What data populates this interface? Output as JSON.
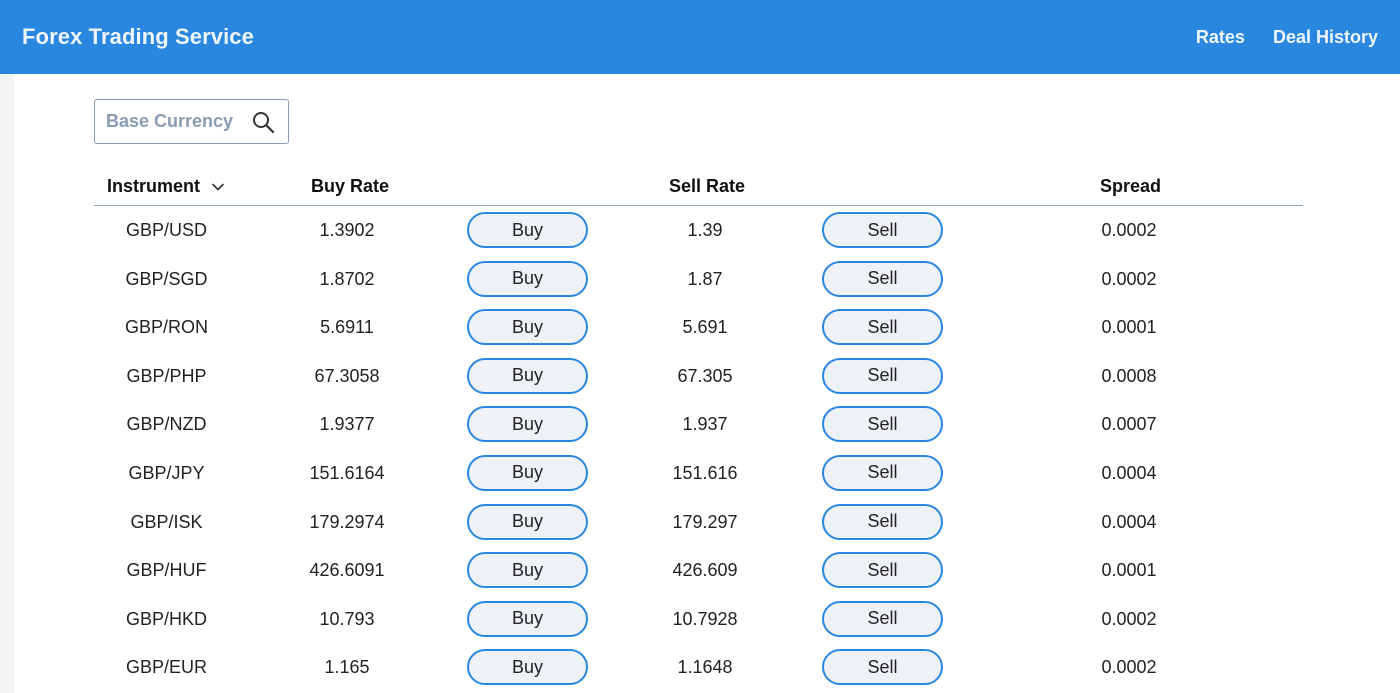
{
  "header": {
    "title": "Forex Trading Service",
    "nav": [
      {
        "label": "Rates"
      },
      {
        "label": "Deal History"
      }
    ],
    "bar_color": "#2a87e0"
  },
  "search": {
    "placeholder": "Base Currency",
    "value": "",
    "icon": "search-icon"
  },
  "table": {
    "headers": {
      "instrument": "Instrument",
      "buy_rate": "Buy Rate",
      "sell_rate": "Sell Rate",
      "spread": "Spread"
    },
    "sort_icon": "chevron-down-icon",
    "buy_label": "Buy",
    "sell_label": "Sell",
    "rows": [
      {
        "instrument": "GBP/USD",
        "buy_rate": "1.3902",
        "sell_rate": "1.39",
        "spread": "0.0002"
      },
      {
        "instrument": "GBP/SGD",
        "buy_rate": "1.8702",
        "sell_rate": "1.87",
        "spread": "0.0002"
      },
      {
        "instrument": "GBP/RON",
        "buy_rate": "5.6911",
        "sell_rate": "5.691",
        "spread": "0.0001"
      },
      {
        "instrument": "GBP/PHP",
        "buy_rate": "67.3058",
        "sell_rate": "67.305",
        "spread": "0.0008"
      },
      {
        "instrument": "GBP/NZD",
        "buy_rate": "1.9377",
        "sell_rate": "1.937",
        "spread": "0.0007"
      },
      {
        "instrument": "GBP/JPY",
        "buy_rate": "151.6164",
        "sell_rate": "151.616",
        "spread": "0.0004"
      },
      {
        "instrument": "GBP/ISK",
        "buy_rate": "179.2974",
        "sell_rate": "179.297",
        "spread": "0.0004"
      },
      {
        "instrument": "GBP/HUF",
        "buy_rate": "426.6091",
        "sell_rate": "426.609",
        "spread": "0.0001"
      },
      {
        "instrument": "GBP/HKD",
        "buy_rate": "10.793",
        "sell_rate": "10.7928",
        "spread": "0.0002"
      },
      {
        "instrument": "GBP/EUR",
        "buy_rate": "1.165",
        "sell_rate": "1.1648",
        "spread": "0.0002"
      }
    ]
  }
}
